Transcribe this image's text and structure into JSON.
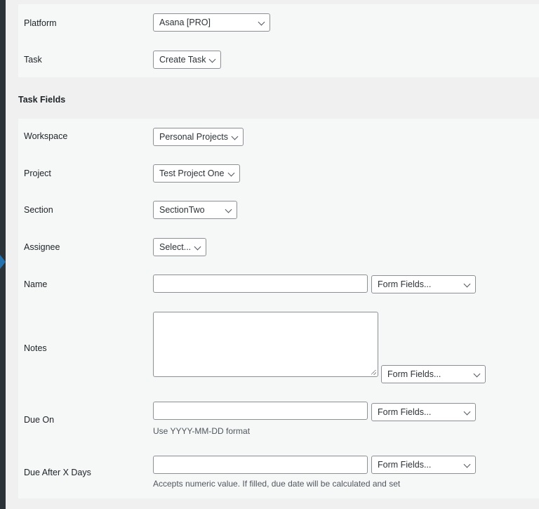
{
  "platform": {
    "label": "Platform",
    "value": "Asana [PRO]"
  },
  "task": {
    "label": "Task",
    "value": "Create Task"
  },
  "section_title": "Task Fields",
  "fields": {
    "workspace": {
      "label": "Workspace",
      "value": "Personal Projects"
    },
    "project": {
      "label": "Project",
      "value": "Test Project One"
    },
    "section": {
      "label": "Section",
      "value": "SectionTwo"
    },
    "assignee": {
      "label": "Assignee",
      "value": "Select..."
    },
    "name": {
      "label": "Name",
      "value": "",
      "form_fields": "Form Fields..."
    },
    "notes": {
      "label": "Notes",
      "value": "",
      "form_fields": "Form Fields..."
    },
    "due_on": {
      "label": "Due On",
      "value": "",
      "form_fields": "Form Fields...",
      "hint": "Use YYYY-MM-DD format"
    },
    "due_after": {
      "label": "Due After X Days",
      "value": "",
      "form_fields": "Form Fields...",
      "hint": "Accepts numeric value. If filled, due date will be calculated and set"
    }
  },
  "colors": {
    "panel": "#f6f7f7",
    "background": "#f0f0f1",
    "border": "#8c8f94",
    "sidebar": "#2c3338",
    "accent": "#2271b1"
  }
}
